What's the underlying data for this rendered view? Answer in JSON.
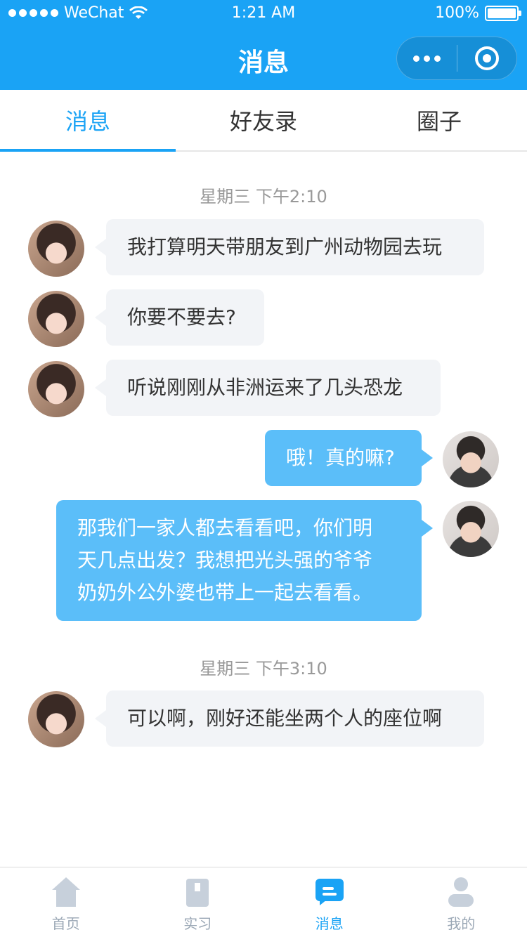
{
  "status_bar": {
    "carrier": "WeChat",
    "time": "1:21 AM",
    "battery": "100%"
  },
  "nav": {
    "title": "消息"
  },
  "tabs": [
    {
      "label": "消息",
      "active": true
    },
    {
      "label": "好友录",
      "active": false
    },
    {
      "label": "圈子",
      "active": false
    }
  ],
  "chat": {
    "time1": "星期三 下午2:10",
    "time2": "星期三 下午3:10",
    "messages": [
      {
        "side": "left",
        "text": "我打算明天带朋友到广州动物园去玩"
      },
      {
        "side": "left",
        "text": "你要不要去?"
      },
      {
        "side": "left",
        "text": "听说刚刚从非洲运来了几头恐龙"
      },
      {
        "side": "right",
        "text": "哦！真的嘛?"
      },
      {
        "side": "right",
        "text": "那我们一家人都去看看吧，你们明\n天几点出发？我想把光头强的爷爷\n奶奶外公外婆也带上一起去看看。"
      },
      {
        "side": "left",
        "text": "可以啊，刚好还能坐两个人的座位啊"
      }
    ]
  },
  "tabbar": [
    {
      "label": "首页",
      "icon": "home-icon",
      "active": false
    },
    {
      "label": "实习",
      "icon": "bookmark-icon",
      "active": false
    },
    {
      "label": "消息",
      "icon": "message-icon",
      "active": true
    },
    {
      "label": "我的",
      "icon": "user-icon",
      "active": false
    }
  ],
  "colors": {
    "primary": "#1AA3F5",
    "bubble_right": "#5BBEF9",
    "bubble_left": "#F2F4F7"
  }
}
